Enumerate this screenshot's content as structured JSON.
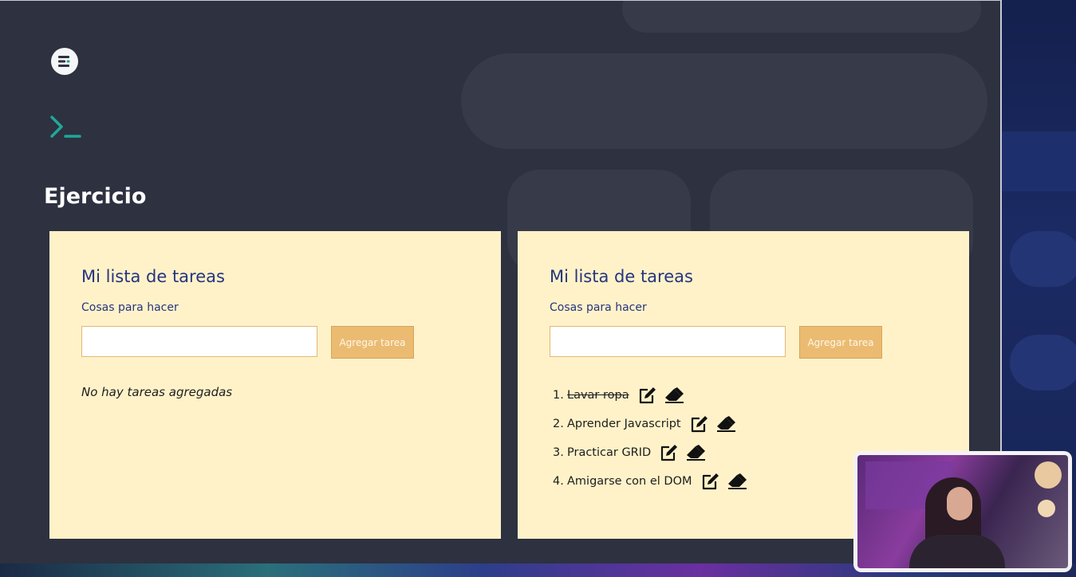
{
  "heading": "Ejercicio",
  "icons": {
    "logo": "stack-lines-icon",
    "prompt": "terminal-prompt-icon",
    "edit": "edit-square-icon",
    "delete": "eraser-icon"
  },
  "colors": {
    "card_bg": "#fff2c9",
    "title_blue": "#26357f",
    "button_orange": "#ebbb72",
    "prompt_teal": "#1fa89a"
  },
  "cards": [
    {
      "title": "Mi lista de tareas",
      "subtitle": "Cosas para hacer",
      "input_value": "",
      "button_label": "Agregar tarea",
      "empty_message": "No hay tareas agregadas",
      "tasks": []
    },
    {
      "title": "Mi lista de tareas",
      "subtitle": "Cosas para hacer",
      "input_value": "",
      "button_label": "Agregar tarea",
      "tasks": [
        {
          "number": "1.",
          "text": "Lavar ropa",
          "done": true
        },
        {
          "number": "2.",
          "text": "Aprender Javascript",
          "done": false
        },
        {
          "number": "3.",
          "text": "Practicar GRID",
          "done": false
        },
        {
          "number": "4.",
          "text": "Amigarse con el DOM",
          "done": false
        }
      ]
    }
  ]
}
